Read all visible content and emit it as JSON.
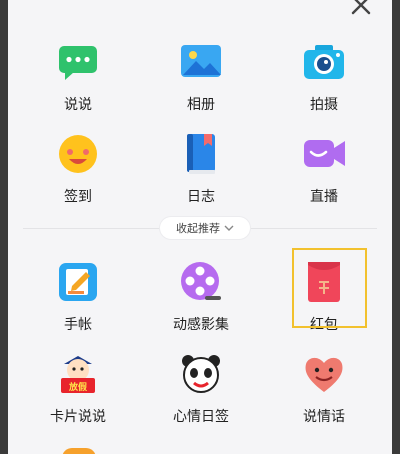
{
  "items": [
    {
      "label": "说说"
    },
    {
      "label": "相册"
    },
    {
      "label": "拍摄"
    },
    {
      "label": "签到"
    },
    {
      "label": "日志"
    },
    {
      "label": "直播"
    },
    {
      "label": "手帐"
    },
    {
      "label": "动感影集"
    },
    {
      "label": "红包"
    },
    {
      "label": "卡片说说"
    },
    {
      "label": "心情日签"
    },
    {
      "label": "说情话"
    }
  ],
  "collapse": {
    "label": "收起推荐"
  },
  "card_badge": {
    "text": "放假"
  },
  "colors": {
    "panel_bg": "#f5f5f7",
    "highlight": "#f2c12e",
    "green": "#2fc26c",
    "blue": "#2a86e8",
    "purple": "#b06cf0",
    "red": "#f0465a"
  }
}
